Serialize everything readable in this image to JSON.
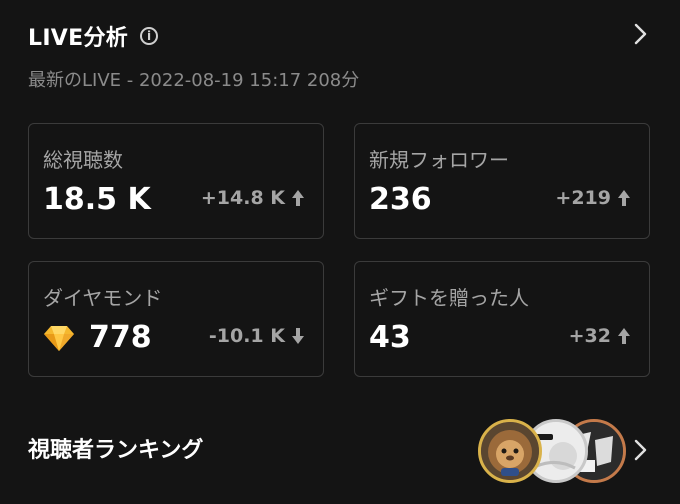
{
  "header": {
    "title": "LIVE分析",
    "info_icon": "info-icon",
    "more_icon": "chevron-right-icon"
  },
  "subtitle": "最新のLIVE - 2022-08-19 15:17 208分",
  "metrics": [
    {
      "label": "総視聴数",
      "value": "18.5 K",
      "delta": "+14.8 K",
      "trend": "up"
    },
    {
      "label": "新規フォロワー",
      "value": "236",
      "delta": "+219",
      "trend": "up"
    },
    {
      "label": "ダイヤモンド",
      "value": "778",
      "delta": "-10.1 K",
      "trend": "down",
      "icon": "diamond-icon"
    },
    {
      "label": "ギフトを贈った人",
      "value": "43",
      "delta": "+32",
      "trend": "up"
    }
  ],
  "ranking": {
    "label": "視聴者ランキング",
    "avatars": [
      "avatar-lion",
      "avatar-white",
      "avatar-dark"
    ],
    "more_icon": "chevron-right-icon"
  },
  "colors": {
    "background": "#141414",
    "card_border": "#3b3b3b",
    "muted_text": "#a5a5a5",
    "diamond": "#f5b82e"
  }
}
